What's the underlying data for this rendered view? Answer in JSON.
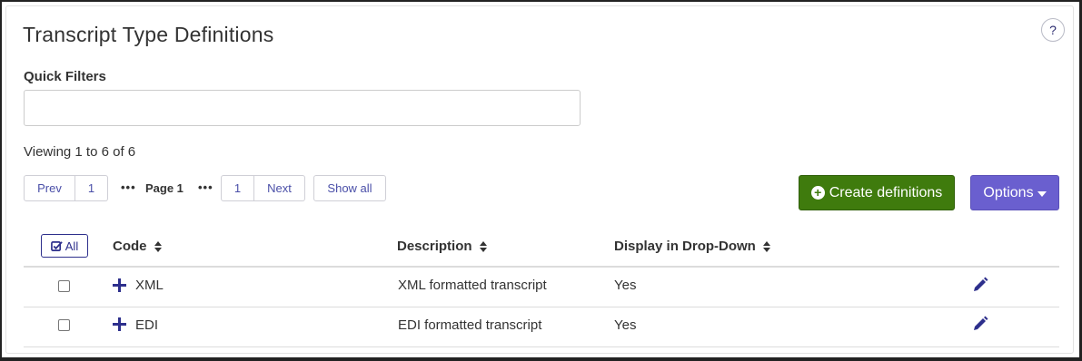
{
  "page": {
    "title": "Transcript Type Definitions",
    "help_label": "?"
  },
  "filters": {
    "label": "Quick Filters",
    "value": "",
    "placeholder": ""
  },
  "viewing_text": "Viewing 1 to 6 of 6",
  "pagination": {
    "prev": "Prev",
    "first_page": "1",
    "ellipsis": "•••",
    "current": "Page 1",
    "last_page": "1",
    "next": "Next",
    "show_all": "Show all"
  },
  "actions": {
    "create": "Create definitions",
    "options": "Options"
  },
  "table": {
    "select_all": "All",
    "columns": [
      "Code",
      "Description",
      "Display in Drop-Down"
    ],
    "rows": [
      {
        "code": "XML",
        "description": "XML formatted transcript",
        "display": "Yes"
      },
      {
        "code": "EDI",
        "description": "EDI formatted transcript",
        "display": "Yes"
      }
    ]
  },
  "colors": {
    "primary_green": "#3f7b0d",
    "options_purple": "#6a5fcf",
    "link_navy": "#2d2f8c"
  },
  "icons": [
    "help-icon",
    "plus-circle-icon",
    "caret-down-icon",
    "check-square-icon",
    "sort-icon",
    "expand-plus-icon",
    "pencil-icon"
  ]
}
